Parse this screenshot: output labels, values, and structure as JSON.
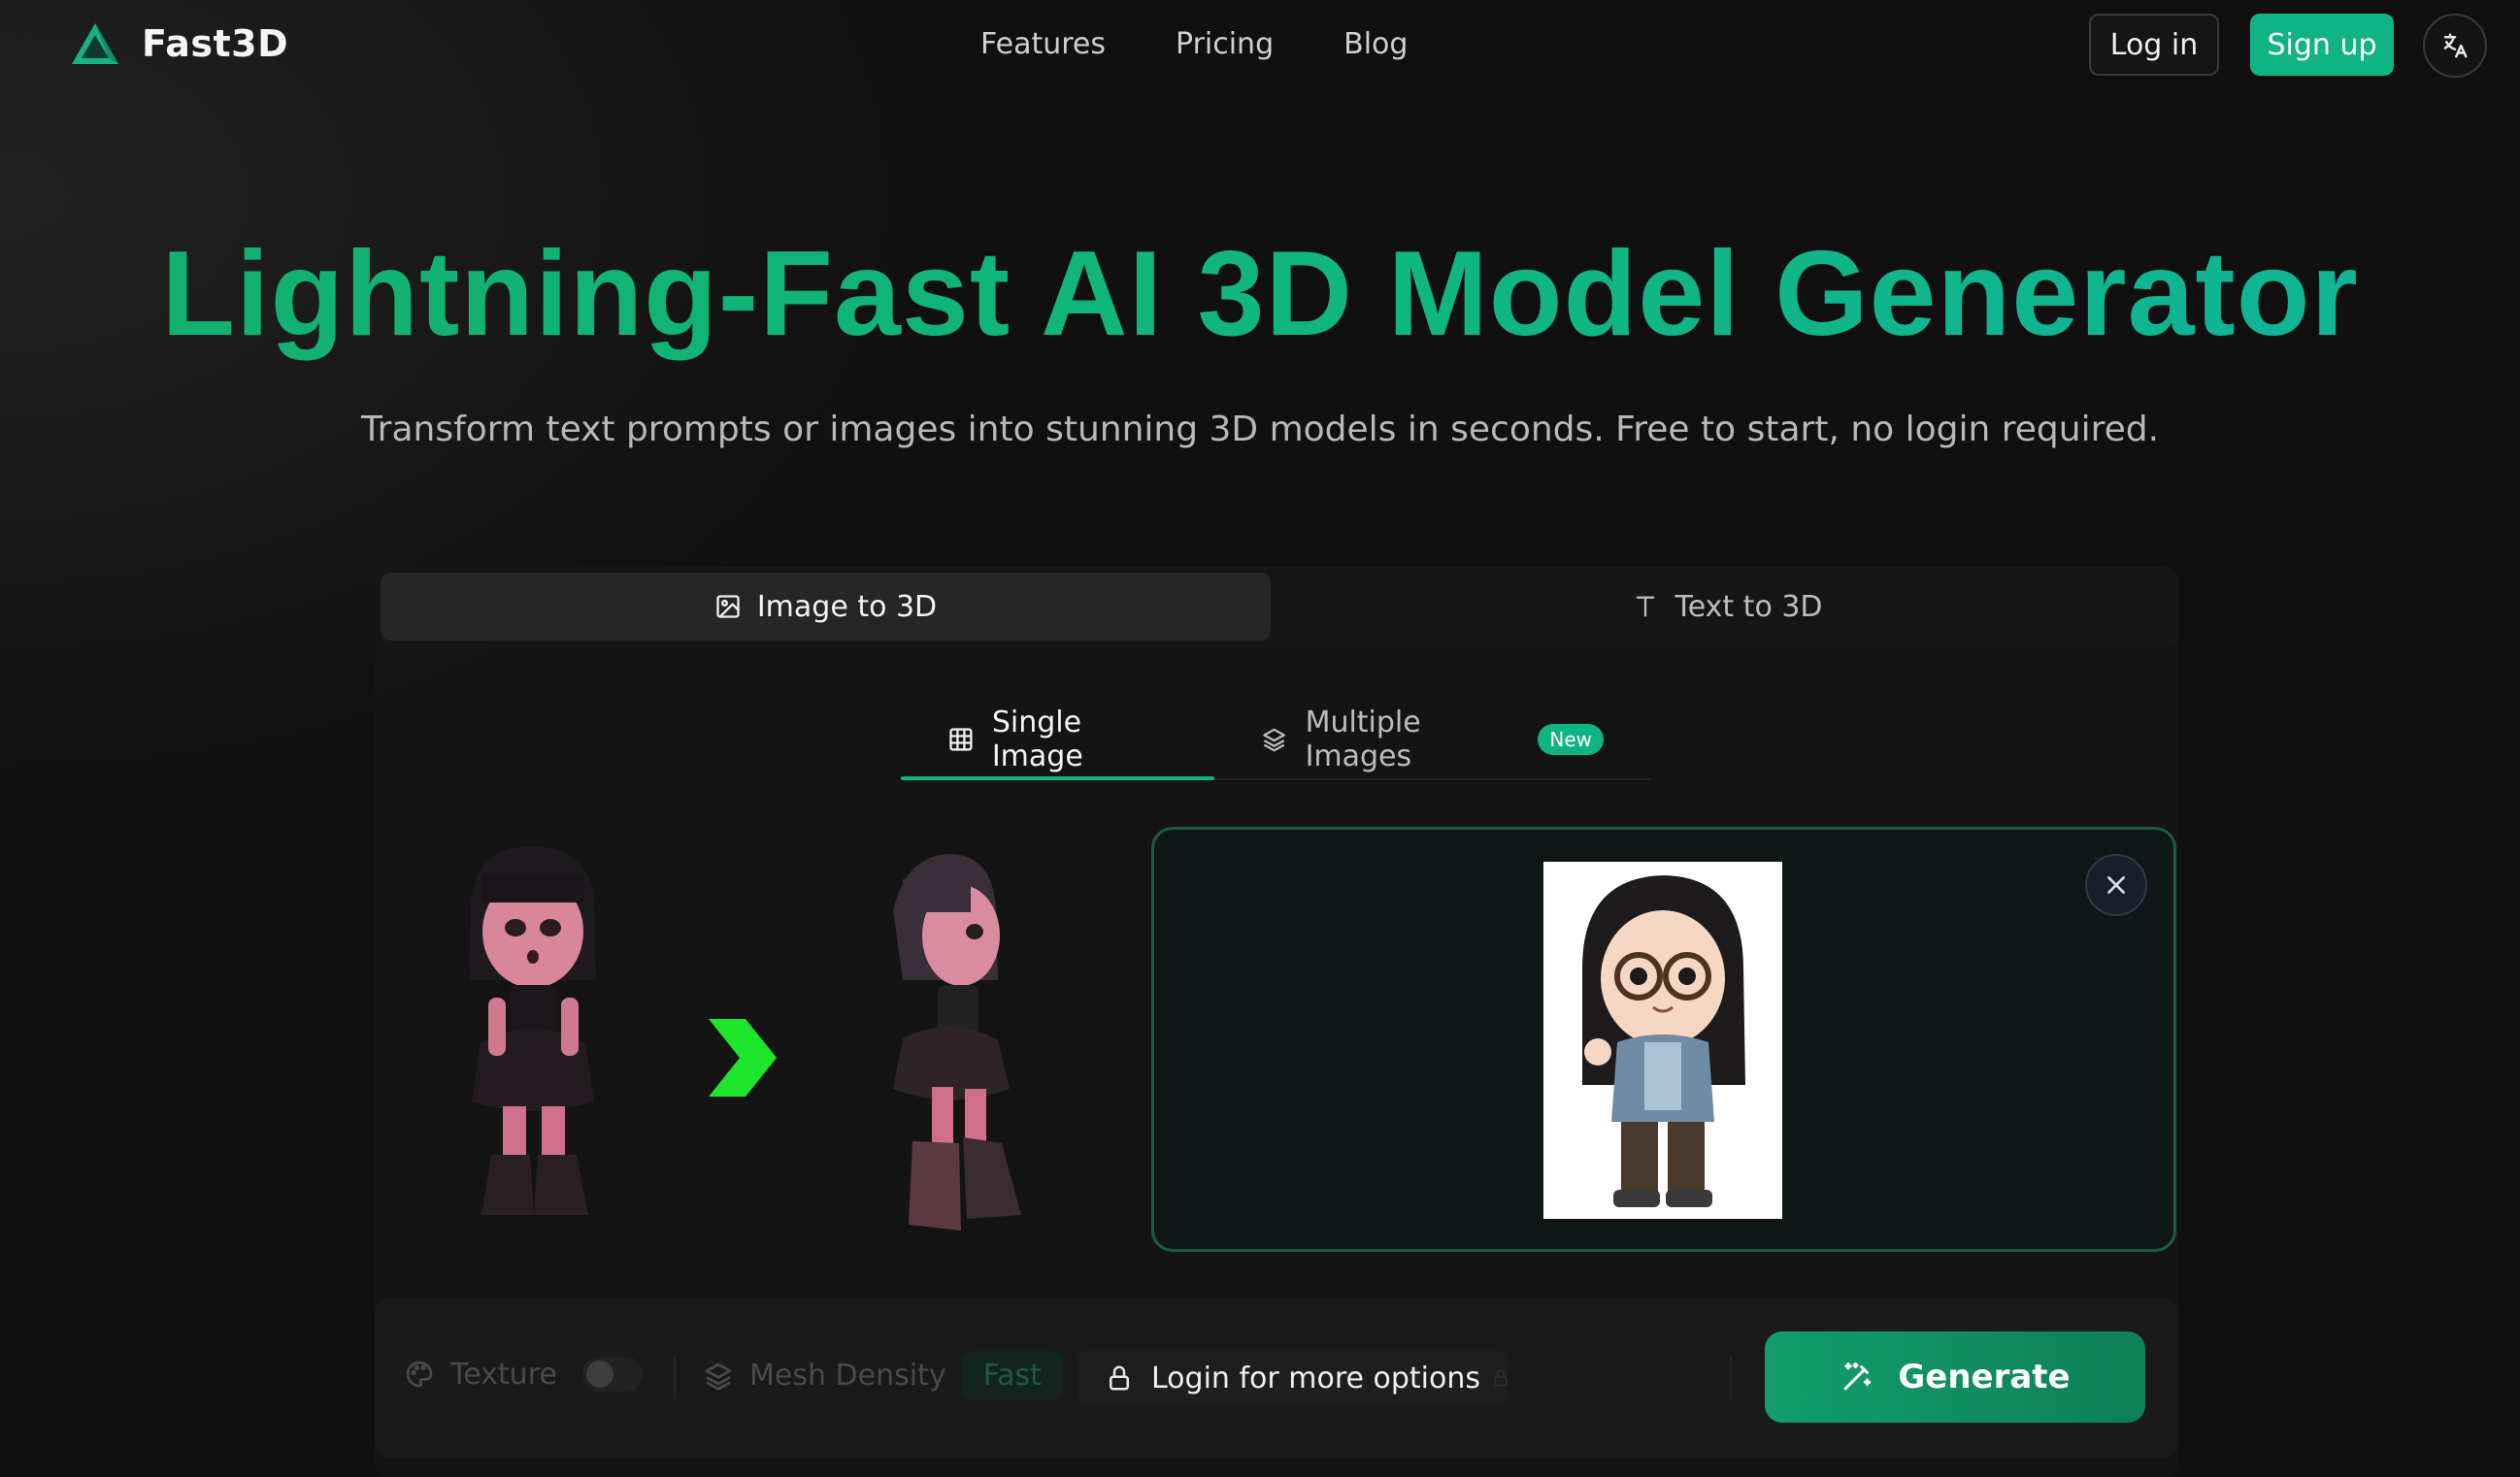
{
  "brand": {
    "name": "Fast3D",
    "accent": "#10b482"
  },
  "nav": {
    "links": [
      "Features",
      "Pricing",
      "Blog"
    ],
    "login_label": "Log in",
    "signup_label": "Sign up",
    "language_icon": "translate-icon"
  },
  "hero": {
    "title": "Lightning-Fast AI 3D Model Generator",
    "subtitle": "Transform text prompts or images into stunning 3D models in seconds. Free to start, no login required."
  },
  "mode_tabs": [
    {
      "label": "Image to 3D",
      "icon": "image-icon",
      "active": true
    },
    {
      "label": "Text to 3D",
      "icon": "text-icon",
      "active": false
    }
  ],
  "sub_tabs": [
    {
      "label": "Single Image",
      "icon": "grid-icon",
      "active": true
    },
    {
      "label": "Multiple Images",
      "icon": "layers-icon",
      "badge": "New",
      "active": false
    }
  ],
  "options": {
    "texture_label": "Texture",
    "mesh_density_label": "Mesh Density",
    "mesh_density_value": "Fast",
    "login_more_label": "Login for more options",
    "generate_label": "Generate"
  }
}
